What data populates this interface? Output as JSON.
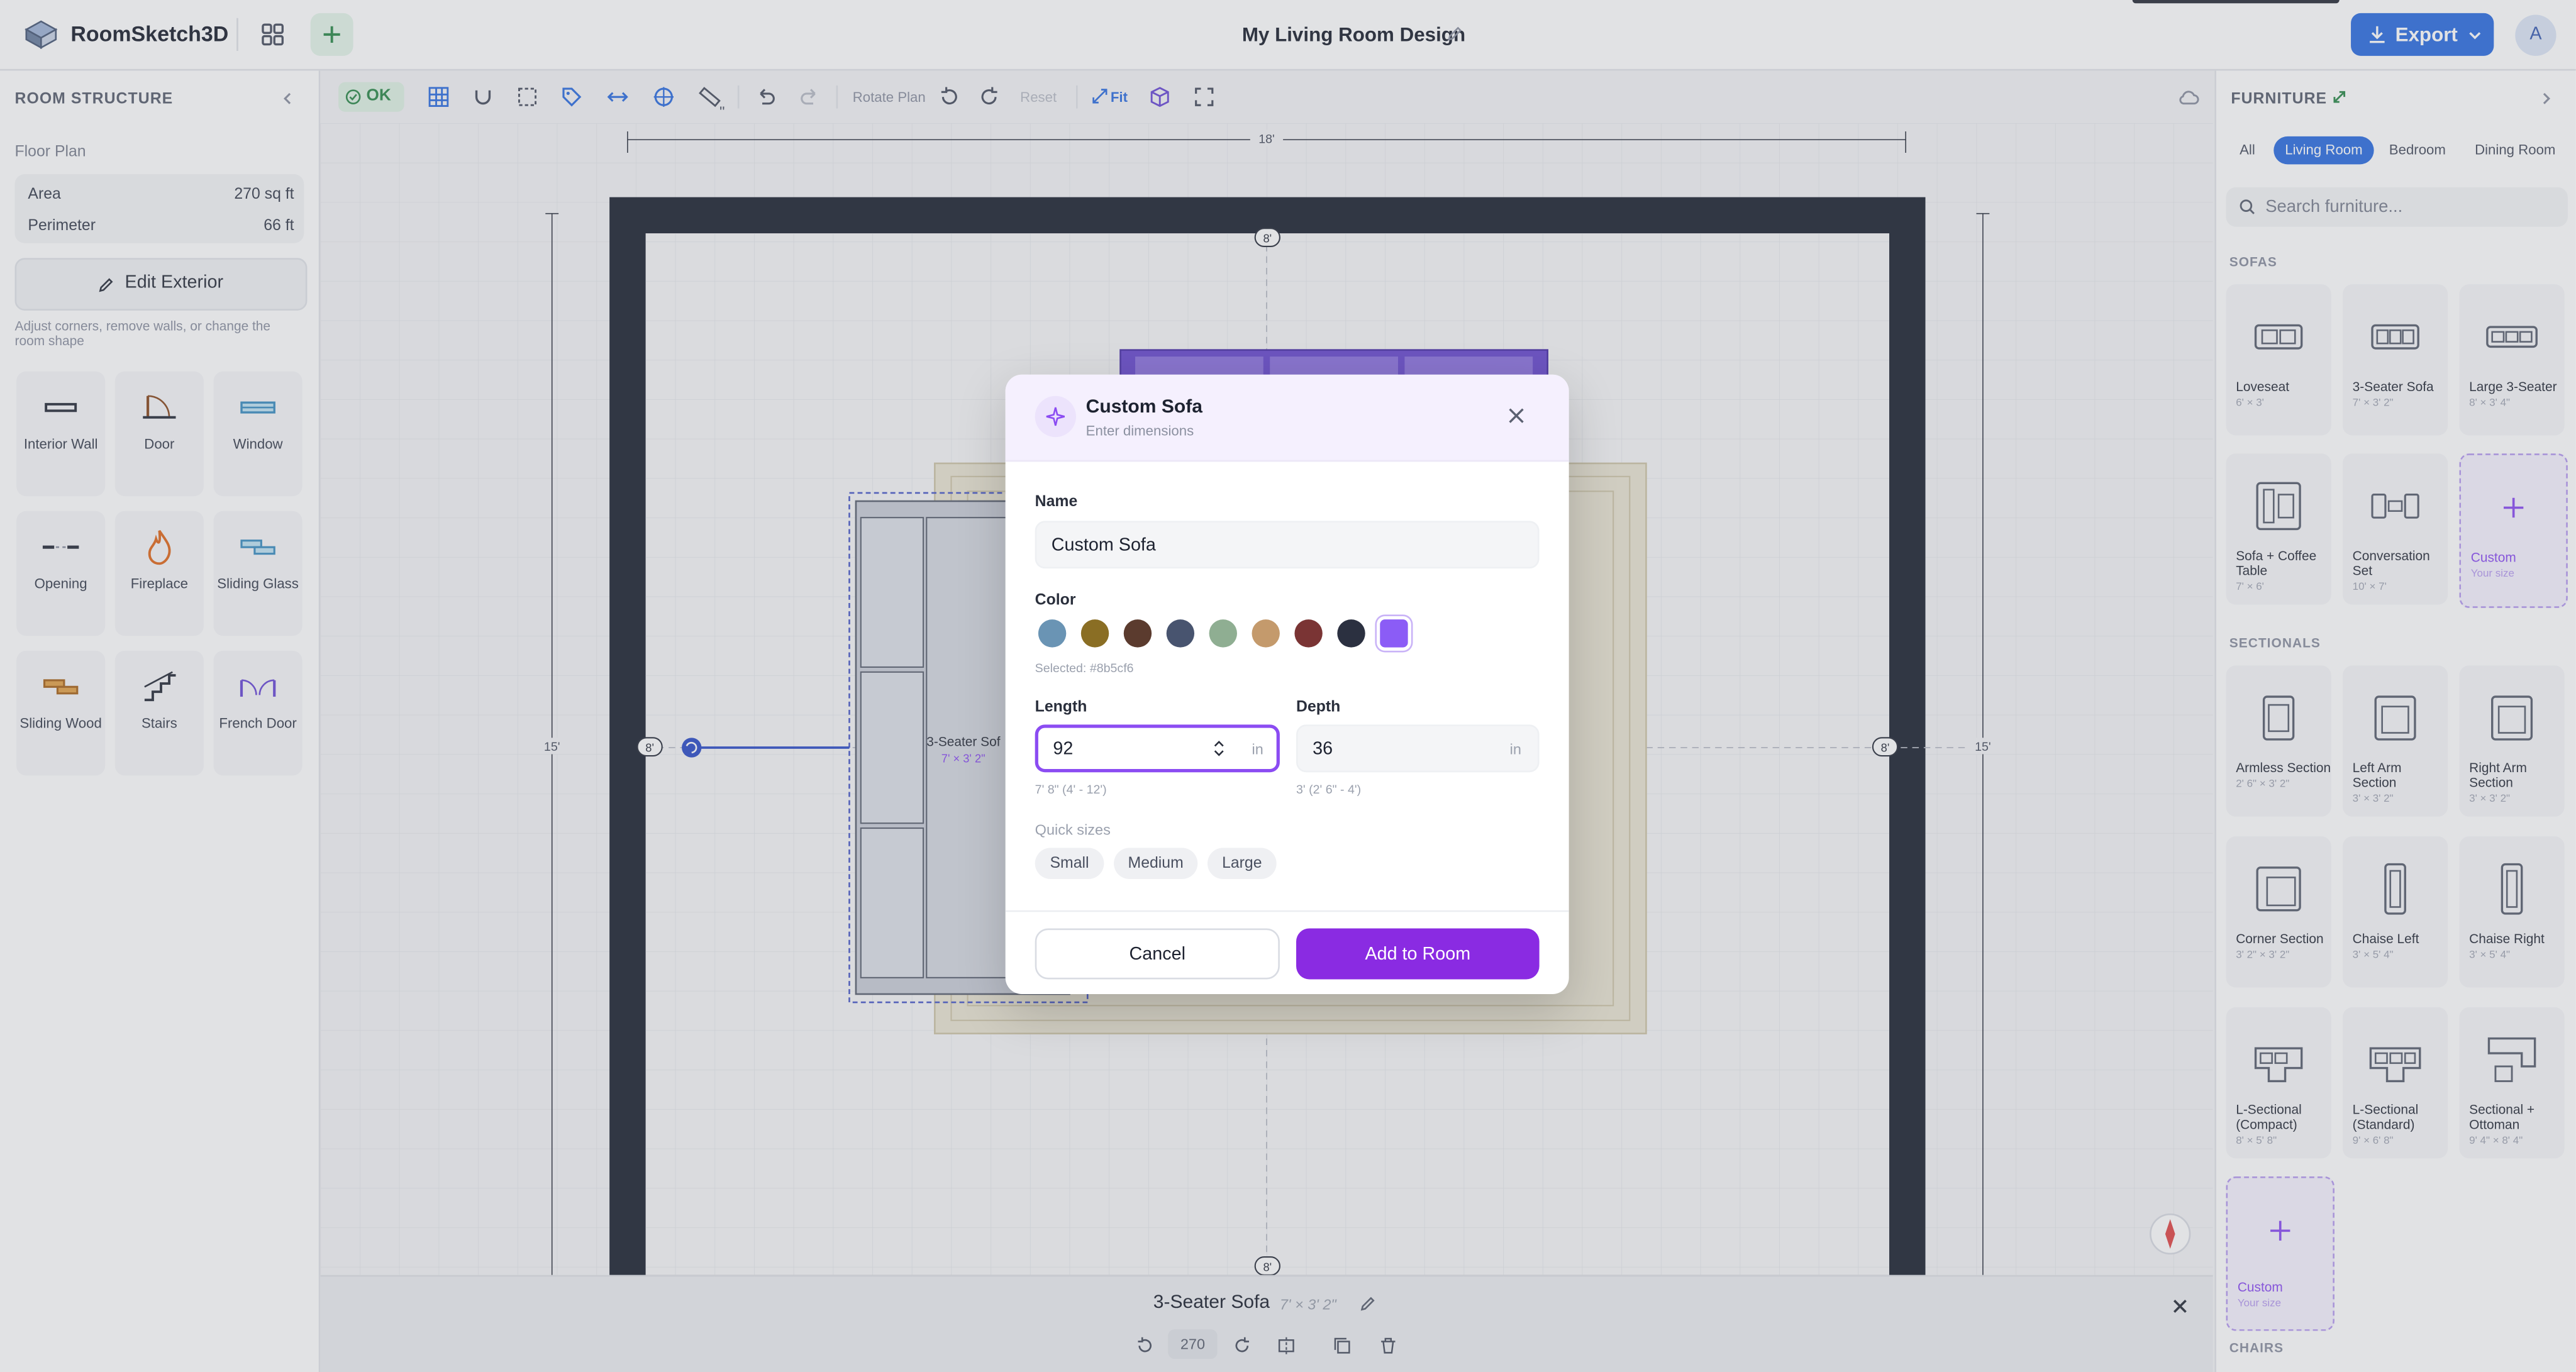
{
  "app": {
    "name": "RoomSketch3D",
    "document_title": "My Living Room Design",
    "export_label": "Export",
    "avatar_initial": "A"
  },
  "room_structure": {
    "title": "ROOM STRUCTURE",
    "floor_plan_label": "Floor Plan",
    "area_label": "Area",
    "area_value": "270 sq ft",
    "perimeter_label": "Perimeter",
    "perimeter_value": "66 ft",
    "edit_exterior_label": "Edit Exterior",
    "hint": "Adjust corners, remove walls, or change the room shape",
    "tools": [
      {
        "label": "Interior Wall"
      },
      {
        "label": "Door"
      },
      {
        "label": "Window"
      },
      {
        "label": "Opening"
      },
      {
        "label": "Fireplace"
      },
      {
        "label": "Sliding Glass"
      },
      {
        "label": "Sliding Wood"
      },
      {
        "label": "Stairs"
      },
      {
        "label": "French Door"
      }
    ]
  },
  "toolbar": {
    "ok_label": "OK",
    "rotate_plan_label": "Rotate Plan",
    "reset_label": "Reset",
    "fit_label": "Fit",
    "quote_mark": "\""
  },
  "plan": {
    "dim_top": "18'",
    "dim_left": "15'",
    "dim_right": "15'",
    "wall_marker_top": "8'",
    "wall_marker_bottom": "8'",
    "wall_marker_left": "8'",
    "wall_marker_right": "8'",
    "sofa_label": "3-Seater Sof",
    "sofa_dims": "7' × 3' 2\""
  },
  "selection_bar": {
    "name": "3-Seater Sofa",
    "dims": "7' × 3' 2\"",
    "rotation_value": "270"
  },
  "furniture": {
    "title": "FURNITURE",
    "tabs": [
      {
        "label": "All"
      },
      {
        "label": "Living Room"
      },
      {
        "label": "Bedroom"
      },
      {
        "label": "Dining Room"
      }
    ],
    "search_placeholder": "Search furniture...",
    "sections": {
      "sofas": "SOFAS",
      "sectionals": "SECTIONALS",
      "chairs": "CHAIRS"
    },
    "sofas": [
      {
        "name": "Loveseat",
        "size": "6' × 3'"
      },
      {
        "name": "3-Seater Sofa",
        "size": "7' × 3' 2\""
      },
      {
        "name": "Large 3-Seater",
        "size": "8' × 3' 4\""
      },
      {
        "name": "Sofa + Coffee Table",
        "size": "7' × 6'"
      },
      {
        "name": "Conversation Set",
        "size": "10' × 7'"
      }
    ],
    "sectionals": [
      {
        "name": "Armless Section",
        "size": "2' 6\" × 3' 2\""
      },
      {
        "name": "Left Arm Section",
        "size": "3' × 3' 2\""
      },
      {
        "name": "Right Arm Section",
        "size": "3' × 3' 2\""
      },
      {
        "name": "Corner Section",
        "size": "3' 2\" × 3' 2\""
      },
      {
        "name": "Chaise Left",
        "size": "3' × 5' 4\""
      },
      {
        "name": "Chaise Right",
        "size": "3' × 5' 4\""
      },
      {
        "name": "L-Sectional (Compact)",
        "size": "8' × 5' 8\""
      },
      {
        "name": "L-Sectional (Standard)",
        "size": "9' × 6' 8\""
      },
      {
        "name": "Sectional + Ottoman",
        "size": "9' 4\" × 8' 4\""
      }
    ],
    "custom_label": "Custom",
    "custom_sub": "Your size"
  },
  "modal": {
    "title": "Custom Sofa",
    "subtitle": "Enter dimensions",
    "name_label": "Name",
    "name_value": "Custom Sofa",
    "color_label": "Color",
    "colors": [
      "#6a94b4",
      "#8a6e24",
      "#5b3b2e",
      "#48546f",
      "#8fae92",
      "#c49a6c",
      "#7a3434",
      "#2b3040",
      "#8b5cf6"
    ],
    "selected_color_text": "Selected: #8b5cf6",
    "length_label": "Length",
    "length_value": "92",
    "length_unit": "in",
    "length_note": "7' 8\" (4' - 12')",
    "depth_label": "Depth",
    "depth_value": "36",
    "depth_unit": "in",
    "depth_note": "3' (2' 6\" - 4')",
    "quick_sizes_label": "Quick sizes",
    "quick_sizes": [
      {
        "label": "Small"
      },
      {
        "label": "Medium"
      },
      {
        "label": "Large"
      }
    ],
    "cancel_label": "Cancel",
    "add_label": "Add to Room"
  }
}
